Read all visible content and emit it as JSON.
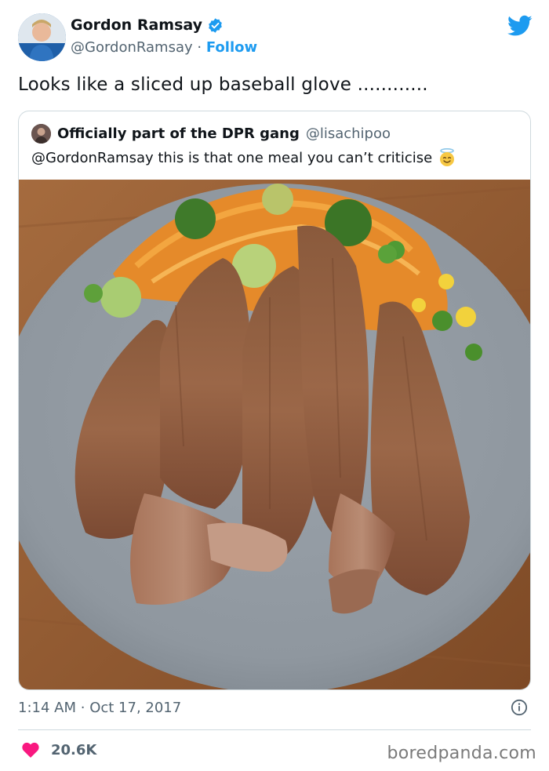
{
  "author": {
    "name": "Gordon Ramsay",
    "handle": "@GordonRamsay",
    "separator": "·",
    "follow_label": "Follow",
    "verified_icon": "verified-badge-icon",
    "brand_icon": "twitter-bird-icon"
  },
  "tweet": {
    "text": "Looks like a sliced up baseball glove ............",
    "time": "1:14 AM",
    "separator": "·",
    "date": "Oct 17, 2017",
    "info_icon": "info-icon"
  },
  "quoted": {
    "name": "Officially part of the DPR gang",
    "handle": "@lisachipoo",
    "text": "@GordonRamsay this is that one meal you can’t criticise",
    "emoji": "smiling-face-with-halo"
  },
  "engagement": {
    "likes": "20.6K",
    "like_icon": "heart-icon"
  },
  "watermark": "boredpanda.com",
  "colors": {
    "accent": "#1d9bf0",
    "heart": "#f91880",
    "text": "#0f1419",
    "muted": "#536471"
  }
}
